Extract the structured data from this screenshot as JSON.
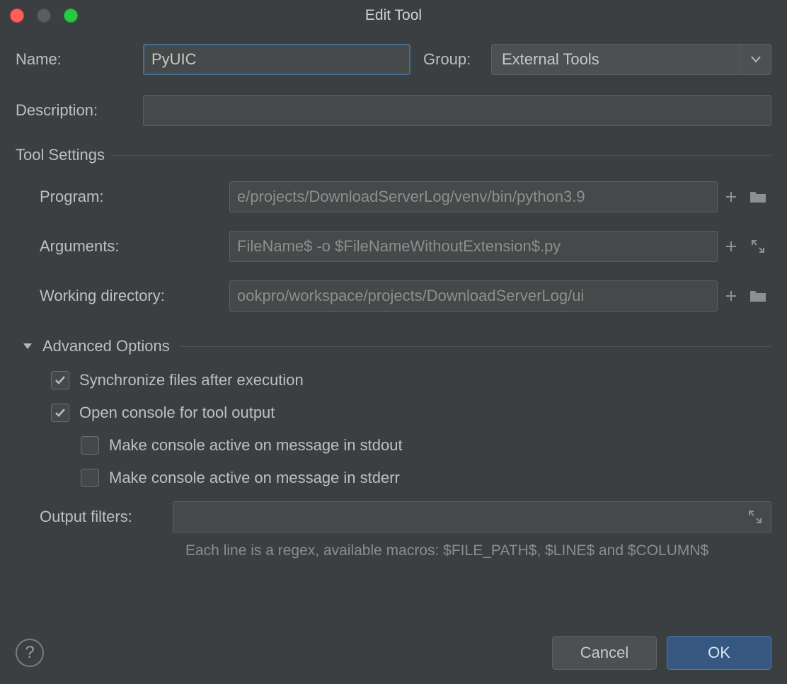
{
  "window": {
    "title": "Edit Tool"
  },
  "fields": {
    "name_label": "Name:",
    "name_value": "PyUIC",
    "group_label": "Group:",
    "group_value": "External Tools",
    "description_label": "Description:",
    "description_value": ""
  },
  "sections": {
    "tool_settings": "Tool Settings",
    "advanced_options": "Advanced Options"
  },
  "tool": {
    "program_label": "Program:",
    "program_value": "e/projects/DownloadServerLog/venv/bin/python3.9",
    "arguments_label": "Arguments:",
    "arguments_value": "FileName$ -o $FileNameWithoutExtension$.py",
    "workdir_label": "Working directory:",
    "workdir_value": "ookpro/workspace/projects/DownloadServerLog/ui"
  },
  "advanced": {
    "sync_label": "Synchronize files after execution",
    "sync_checked": true,
    "open_console_label": "Open console for tool output",
    "open_console_checked": true,
    "stdout_label": "Make console active on message in stdout",
    "stdout_checked": false,
    "stderr_label": "Make console active on message in stderr",
    "stderr_checked": false,
    "output_filters_label": "Output filters:",
    "output_filters_value": "",
    "hint": "Each line is a regex, available macros: $FILE_PATH$, $LINE$ and $COLUMN$"
  },
  "footer": {
    "cancel": "Cancel",
    "ok": "OK",
    "help": "?"
  }
}
